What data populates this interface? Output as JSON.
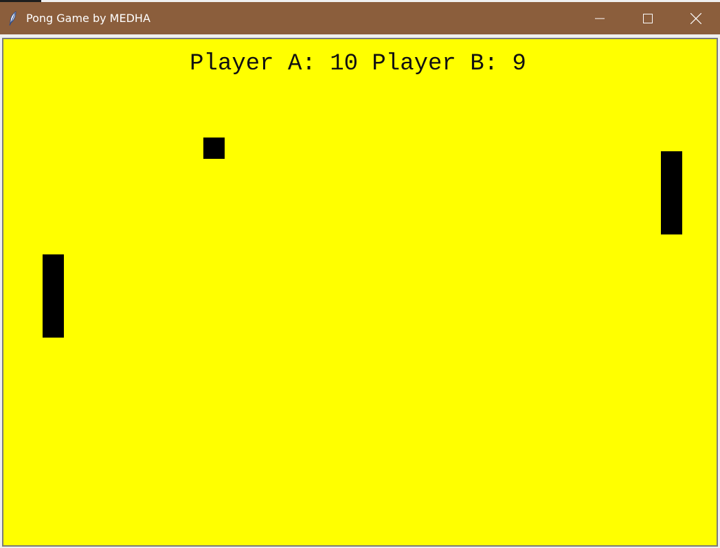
{
  "window": {
    "title": "Pong Game by MEDHA",
    "app_icon": "feather-icon",
    "controls": [
      "minimize-icon",
      "maximize-icon",
      "close-icon"
    ],
    "titlebar_color": "#8b5e3c"
  },
  "game": {
    "background_color": "#ffff00",
    "object_color": "#000000",
    "score": {
      "label_a": "Player A:",
      "value_a": "10",
      "label_b": "Player B:",
      "value_b": "9"
    }
  }
}
